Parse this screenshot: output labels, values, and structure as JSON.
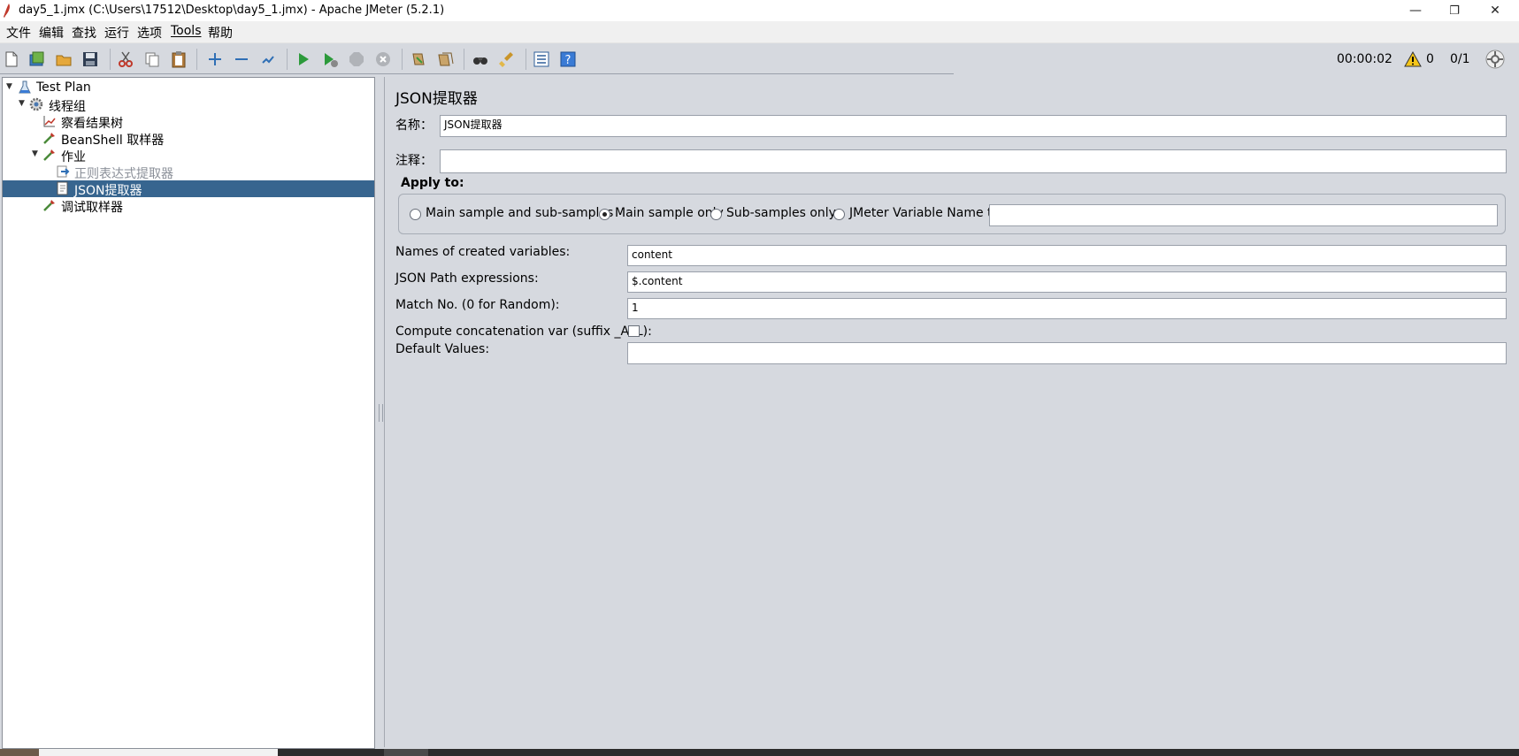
{
  "window": {
    "title": "day5_1.jmx (C:\\Users\\17512\\Desktop\\day5_1.jmx) - Apache JMeter (5.2.1)",
    "minimize_glyph": "—",
    "maximize_glyph": "❐",
    "close_glyph": "✕"
  },
  "menu": {
    "items": [
      "文件",
      "编辑",
      "查找",
      "运行",
      "选项",
      "Tools",
      "帮助"
    ]
  },
  "toolbar": {
    "icons": [
      "new-icon",
      "templates-icon",
      "open-icon",
      "save-icon",
      "cut-icon",
      "copy-icon",
      "paste-icon",
      "expand-icon",
      "collapse-icon",
      "toggle-icon",
      "start-icon",
      "start-no-pause-icon",
      "stop-icon",
      "shutdown-icon",
      "clear-icon",
      "clear-all-icon",
      "search-icon",
      "reset-search-icon",
      "function-helper-icon",
      "help-icon"
    ],
    "elapsed_time": "00:00:02",
    "warning_count": "0",
    "threads": "0/1"
  },
  "tree": {
    "items": [
      {
        "label": "Test Plan",
        "icon": "flask-icon",
        "expanded": true
      },
      {
        "label": "线程组",
        "icon": "gear-icon",
        "expanded": true
      },
      {
        "label": "察看结果树",
        "icon": "graph-icon"
      },
      {
        "label": "BeanShell 取样器",
        "icon": "pipette-icon"
      },
      {
        "label": "作业",
        "icon": "pipette-icon",
        "expanded": true
      },
      {
        "label": "正则表达式提取器",
        "icon": "extractor-icon",
        "disabled": true
      },
      {
        "label": "JSON提取器",
        "icon": "document-icon",
        "selected": true
      },
      {
        "label": "调试取样器",
        "icon": "pipette-icon"
      }
    ]
  },
  "panel": {
    "title": "JSON提取器",
    "name_label": "名称：",
    "name_value": "JSON提取器",
    "comment_label": "注释：",
    "comment_value": "",
    "apply_to": {
      "label": "Apply to:",
      "options": [
        "Main sample and sub-samples",
        "Main sample only",
        "Sub-samples only",
        "JMeter Variable Name to use"
      ],
      "selected": "Main sample only",
      "variable_name": ""
    },
    "fields": {
      "names_label": "Names of created variables:",
      "names_value": "content",
      "json_path_label": "JSON Path expressions:",
      "json_path_value": "$.content",
      "match_no_label": "Match No. (0 for Random):",
      "match_no_value": "1",
      "concat_label": "Compute concatenation var (suffix _ALL):",
      "concat_checked": false,
      "default_label": "Default Values:",
      "default_value": ""
    }
  },
  "colors": {
    "selection": "#37658f",
    "panel_bg": "#d6d9df"
  }
}
